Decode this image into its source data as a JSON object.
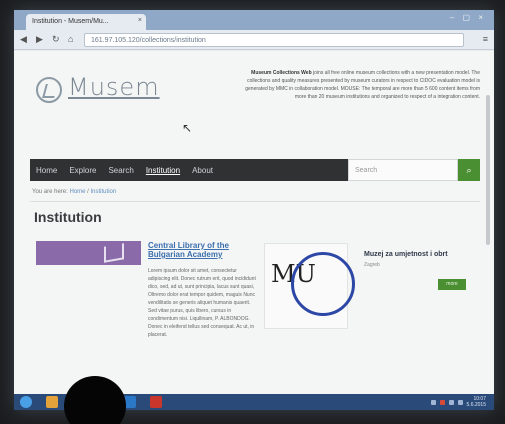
{
  "browser": {
    "tab_title": "Institution - Musem/Mu...",
    "tab_close": "×",
    "window_controls": "– ▢ ×",
    "back_icon": "arrow-left-icon",
    "forward_icon": "arrow-right-icon",
    "reload_icon": "reload-icon",
    "address": "161.97.105.120/collections/institution"
  },
  "site": {
    "logo_text": "Musem",
    "intro_bold": "Museum Collections Web",
    "intro_text": "joins all free online museum collections with a new presentation model. The collections and quality measures presented by museum curators in respect to CIDOC evaluation model is generated by MMC in collaboration model. MOUSE: The temporal are more than 5 600 content items from more than 20 museum institutions and organized to respect of a integration content.",
    "nav": [
      "Home",
      "Explore",
      "Search",
      "Institution",
      "About"
    ],
    "nav_active_index": 3,
    "search_placeholder": "Search",
    "search_icon": "search-icon",
    "breadcrumb_prefix": "You are here:",
    "breadcrumb_home": "Home",
    "breadcrumb_current": "Institution",
    "page_title": "Institution"
  },
  "cards": {
    "left_title": "Central Library of the Bulgarian Academy",
    "left_body": "Lorem ipsum dolor sit amet, consectetur adipiscing elit. Donec rutrum erit, quod incididunt dico, sed, ad ut, sunt principia, lacus sunt quasi, Oltremo dolor erat tempor quidem, maguis Nunc vendilitatis se generis aliquet humanis quaerit. Sed vitae purus, quis libero, cursus in condimentum nisi. Liqullinam, P. ALBONDOG. Donec in eleifend tellus sed consequat. Ac ut, in placerat.",
    "right_logo": "MU",
    "right_title": "Muzej za umjetnost i obrt",
    "right_sub": "Zagreb",
    "right_button": "more"
  },
  "colors": {
    "nav_bg": "#2f3133",
    "accent_green": "#4a8f31",
    "link_blue": "#3b6fae",
    "card_purple": "#8a6aa8",
    "mu_circle": "#2c47a6",
    "taskbar": "#2a4a7a"
  },
  "taskbar": {
    "clock_time": "10:07",
    "clock_date": "5.6.2015"
  }
}
